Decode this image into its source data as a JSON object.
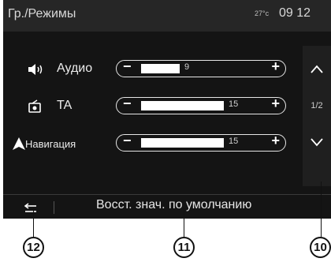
{
  "header": {
    "title": "Гр./Режимы",
    "temperature": "27°c",
    "time": "09 12"
  },
  "rows": [
    {
      "label": "Аудио",
      "value": "9",
      "icon": "speaker-icon"
    },
    {
      "label": "TA",
      "value": "15",
      "icon": "radio-icon"
    },
    {
      "label": "Навигация",
      "value": "15",
      "icon": "navigation-arrow-icon"
    }
  ],
  "stepper": {
    "minus": "−",
    "plus": "+"
  },
  "pager": {
    "page": "1/2",
    "up_icon": "chevron-up-icon",
    "down_icon": "chevron-down-icon"
  },
  "footer": {
    "back_icon": "back-arrow-icon",
    "reset_label": "Восст. знач. по умолчанию"
  },
  "callouts": [
    "12",
    "11",
    "10"
  ],
  "colors": {
    "background": "#141414",
    "header": "#262626",
    "text": "#ececec"
  }
}
